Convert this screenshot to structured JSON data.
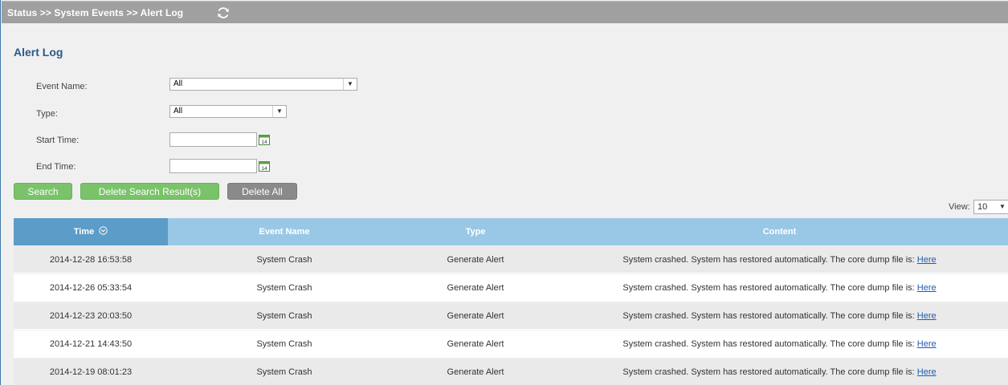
{
  "breadcrumb": "Status >> System Events >> Alert Log",
  "page_title": "Alert Log",
  "filters": {
    "event_name_label": "Event Name:",
    "event_name_value": "All",
    "type_label": "Type:",
    "type_value": "All",
    "start_time_label": "Start Time:",
    "end_time_label": "End Time:",
    "calendar_day": "14"
  },
  "buttons": {
    "search": "Search",
    "delete_search": "Delete Search Result(s)",
    "delete_all": "Delete All"
  },
  "view": {
    "label": "View:",
    "value": "10"
  },
  "table": {
    "headers": {
      "time": "Time",
      "event_name": "Event Name",
      "type": "Type",
      "content": "Content"
    },
    "sort_icon": "chevron-down-circle-icon",
    "rows": [
      {
        "time": "2014-12-28 16:53:58",
        "event_name": "System Crash",
        "type": "Generate Alert",
        "content": "System crashed. System has restored automatically. The core dump file is:",
        "link": "Here"
      },
      {
        "time": "2014-12-26 05:33:54",
        "event_name": "System Crash",
        "type": "Generate Alert",
        "content": "System crashed. System has restored automatically. The core dump file is:",
        "link": "Here"
      },
      {
        "time": "2014-12-23 20:03:50",
        "event_name": "System Crash",
        "type": "Generate Alert",
        "content": "System crashed. System has restored automatically. The core dump file is:",
        "link": "Here"
      },
      {
        "time": "2014-12-21 14:43:50",
        "event_name": "System Crash",
        "type": "Generate Alert",
        "content": "System crashed. System has restored automatically. The core dump file is:",
        "link": "Here"
      },
      {
        "time": "2014-12-19 08:01:23",
        "event_name": "System Crash",
        "type": "Generate Alert",
        "content": "System crashed. System has restored automatically. The core dump file is:",
        "link": "Here"
      }
    ]
  },
  "colors": {
    "header_bar": "#a0a0a0",
    "title": "#2b5a8a",
    "button_green": "#7ac36a",
    "button_gray": "#8a8a8a",
    "table_header": "#99c8e6",
    "table_header_active": "#5b9cc8",
    "link": "#1f5bb6"
  }
}
